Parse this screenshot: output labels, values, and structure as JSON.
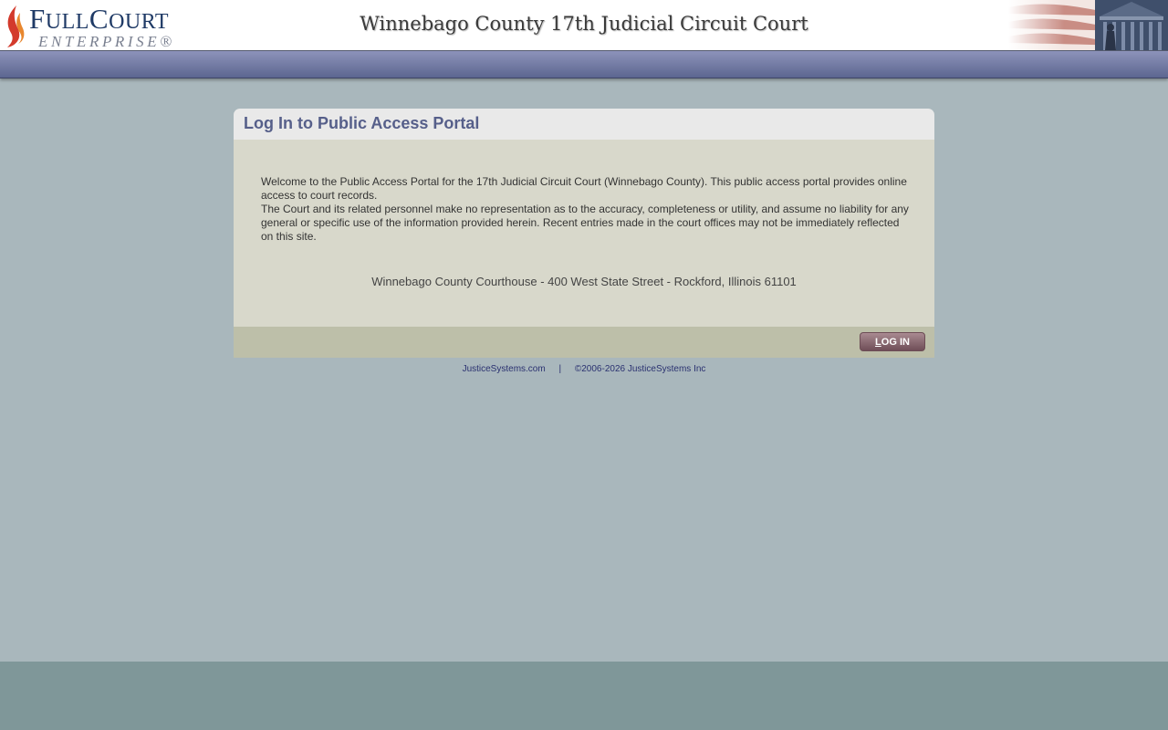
{
  "header": {
    "logo_main_first": "F",
    "logo_main_rest1": "ULL",
    "logo_main_c": "C",
    "logo_main_rest2": "OURT",
    "logo_sub": "ENTERPRISE®",
    "title": "Winnebago County 17th Judicial Circuit Court"
  },
  "panel": {
    "title": "Log In to Public Access Portal",
    "welcome_line1": "Welcome to the Public Access Portal for the 17th Judicial Circuit Court (Winnebago County). This public access portal provides online access to court records.",
    "welcome_line2": "The Court and its related personnel make no representation as to the accuracy, completeness or utility, and assume no liability for any general or specific use of the information provided herein. Recent entries made in the court offices may not be immediately reflected on this site.",
    "address": "Winnebago County Courthouse - 400 West State Street - Rockford, Illinois 61101",
    "login_label_first": "L",
    "login_label_rest": "OG IN"
  },
  "footer": {
    "link_label": "JusticeSystems.com",
    "separator": "|",
    "copyright": "©2006-2026 JusticeSystems Inc"
  },
  "colors": {
    "page_background": "#a9b7bc",
    "navbar": "#6e77a0",
    "panel_title": "#565f8a",
    "panel_body": "#d8d8cb",
    "panel_footer": "#bdbfa9",
    "login_button": "#8c6b73",
    "bottom_band": "#7f9799"
  },
  "icons": {
    "logo_flame": "flame-icon",
    "header_art": "flag-and-justice-statue-image"
  }
}
